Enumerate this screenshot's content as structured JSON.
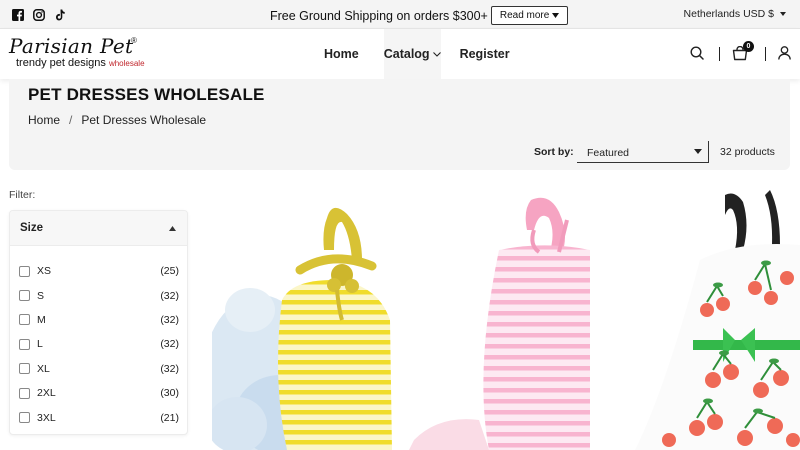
{
  "announcement": {
    "social_icons": [
      "facebook-icon",
      "instagram-icon",
      "tiktok-icon"
    ],
    "text": "Free Ground Shipping on orders $300+",
    "read_more": "Read more",
    "locale": "Netherlands USD $"
  },
  "header": {
    "logo_text": "Parisian Pet",
    "logo_registered": "®",
    "logo_tagline": "trendy pet designs",
    "logo_wholesale": "wholesale",
    "nav": [
      {
        "label": "Home"
      },
      {
        "label": "Catalog"
      },
      {
        "label": "Register"
      }
    ],
    "icons": [
      "search-icon",
      "cart-icon",
      "account-icon"
    ],
    "cart_count": "0"
  },
  "page": {
    "title": "PET DRESSES WHOLESALE",
    "breadcrumb": [
      {
        "label": "Home"
      },
      {
        "label": "/"
      },
      {
        "label": "Pet Dresses Wholesale"
      }
    ]
  },
  "toolbar": {
    "sort_label": "Sort by:",
    "sort_value": "Featured",
    "product_count": "32 products"
  },
  "filter": {
    "label": "Filter:",
    "group_title": "Size",
    "options": [
      {
        "label": "XS",
        "count": "(25)"
      },
      {
        "label": "S",
        "count": "(32)"
      },
      {
        "label": "M",
        "count": "(32)"
      },
      {
        "label": "L",
        "count": "(32)"
      },
      {
        "label": "XL",
        "count": "(32)"
      },
      {
        "label": "2XL",
        "count": "(30)"
      },
      {
        "label": "3XL",
        "count": "(21)"
      }
    ]
  },
  "products": [
    {
      "image": "yellow-striped-dress-with-blue-tutu"
    },
    {
      "image": "pink-striped-dress"
    },
    {
      "image": "white-cherry-print-dress"
    }
  ],
  "colors": {
    "topbar_bg": "#f4f4f4",
    "title_bg": "#f4f4f4",
    "logo_accent": "#c0262c",
    "text": "#222222"
  }
}
